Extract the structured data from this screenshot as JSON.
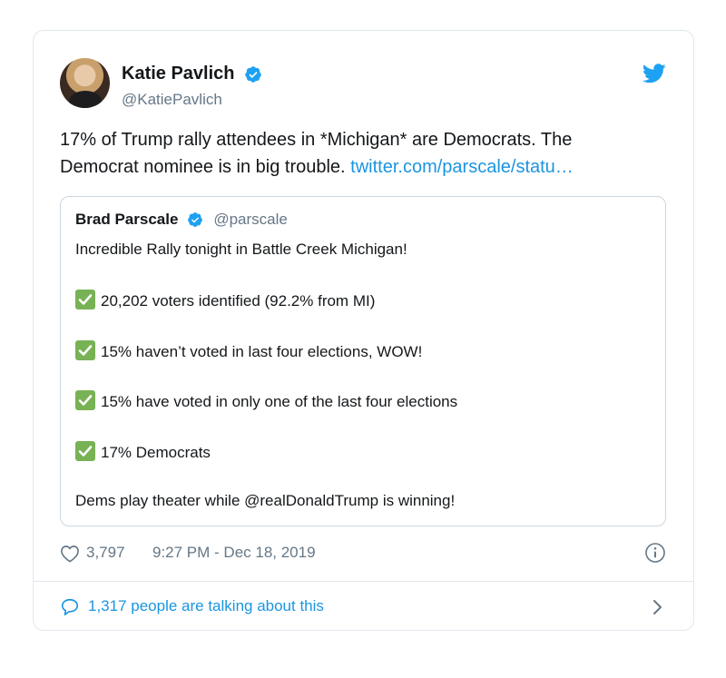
{
  "tweet": {
    "author_name": "Katie Pavlich",
    "author_handle": "@KatiePavlich",
    "text_line1": "17% of Trump rally attendees in *Michigan* are Democrats. The",
    "text_line2": "Democrat nominee is in big trouble. ",
    "link_text": "twitter.com/parscale/statu…",
    "likes": "3,797",
    "timestamp": "9:27 PM - Dec 18, 2019",
    "talking_text": "1,317 people are talking about this"
  },
  "quote": {
    "author_name": "Brad Parscale",
    "author_handle": "@parscale",
    "intro": "Incredible Rally tonight in Battle Creek Michigan!",
    "items": [
      "20,202 voters identified (92.2% from MI)",
      "15% haven’t voted in last four elections, WOW!",
      "15% have voted in only one of the last four elections",
      "17% Democrats"
    ],
    "outro": "Dems play theater while @realDonaldTrump is winning!"
  },
  "icons": {
    "verified": "verified-badge-icon",
    "bird": "twitter-bird-icon",
    "heart": "heart-icon",
    "info": "info-icon",
    "bubble": "speech-bubble-icon",
    "chevron": "chevron-right-icon",
    "check": "white-check-mark-icon"
  },
  "colors": {
    "accent": "#1da1f2",
    "link": "#1b95e0",
    "muted": "#657786",
    "check_green": "#77b255"
  }
}
